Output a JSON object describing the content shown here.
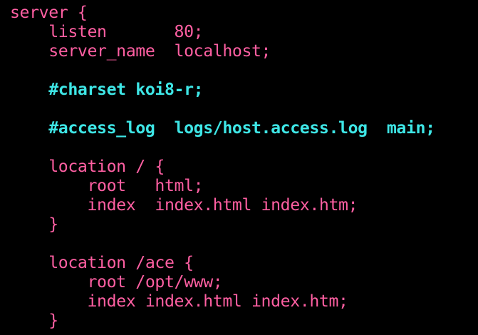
{
  "editor": {
    "lines": [
      {
        "text": "server {",
        "kind": "code"
      },
      {
        "text": "    listen       80;",
        "kind": "code"
      },
      {
        "text": "    server_name  localhost;",
        "kind": "code"
      },
      {
        "text": "",
        "kind": "code"
      },
      {
        "text": "    #charset koi8-r;",
        "kind": "comment"
      },
      {
        "text": "",
        "kind": "code"
      },
      {
        "text": "    #access_log  logs/host.access.log  main;",
        "kind": "comment"
      },
      {
        "text": "",
        "kind": "code"
      },
      {
        "text": "    location / {",
        "kind": "code"
      },
      {
        "text": "        root   html;",
        "kind": "code"
      },
      {
        "text": "        index  index.html index.htm;",
        "kind": "code"
      },
      {
        "text": "    }",
        "kind": "code"
      },
      {
        "text": "",
        "kind": "code"
      },
      {
        "text": "    location /ace {",
        "kind": "code"
      },
      {
        "text": "        root /opt/www;",
        "kind": "code"
      },
      {
        "text": "        index index.html index.htm;",
        "kind": "code"
      },
      {
        "text": "    }",
        "kind": "code"
      }
    ]
  },
  "colors": {
    "background": "#000000",
    "code": "#ff5fa2",
    "comment": "#3ee6e6"
  }
}
